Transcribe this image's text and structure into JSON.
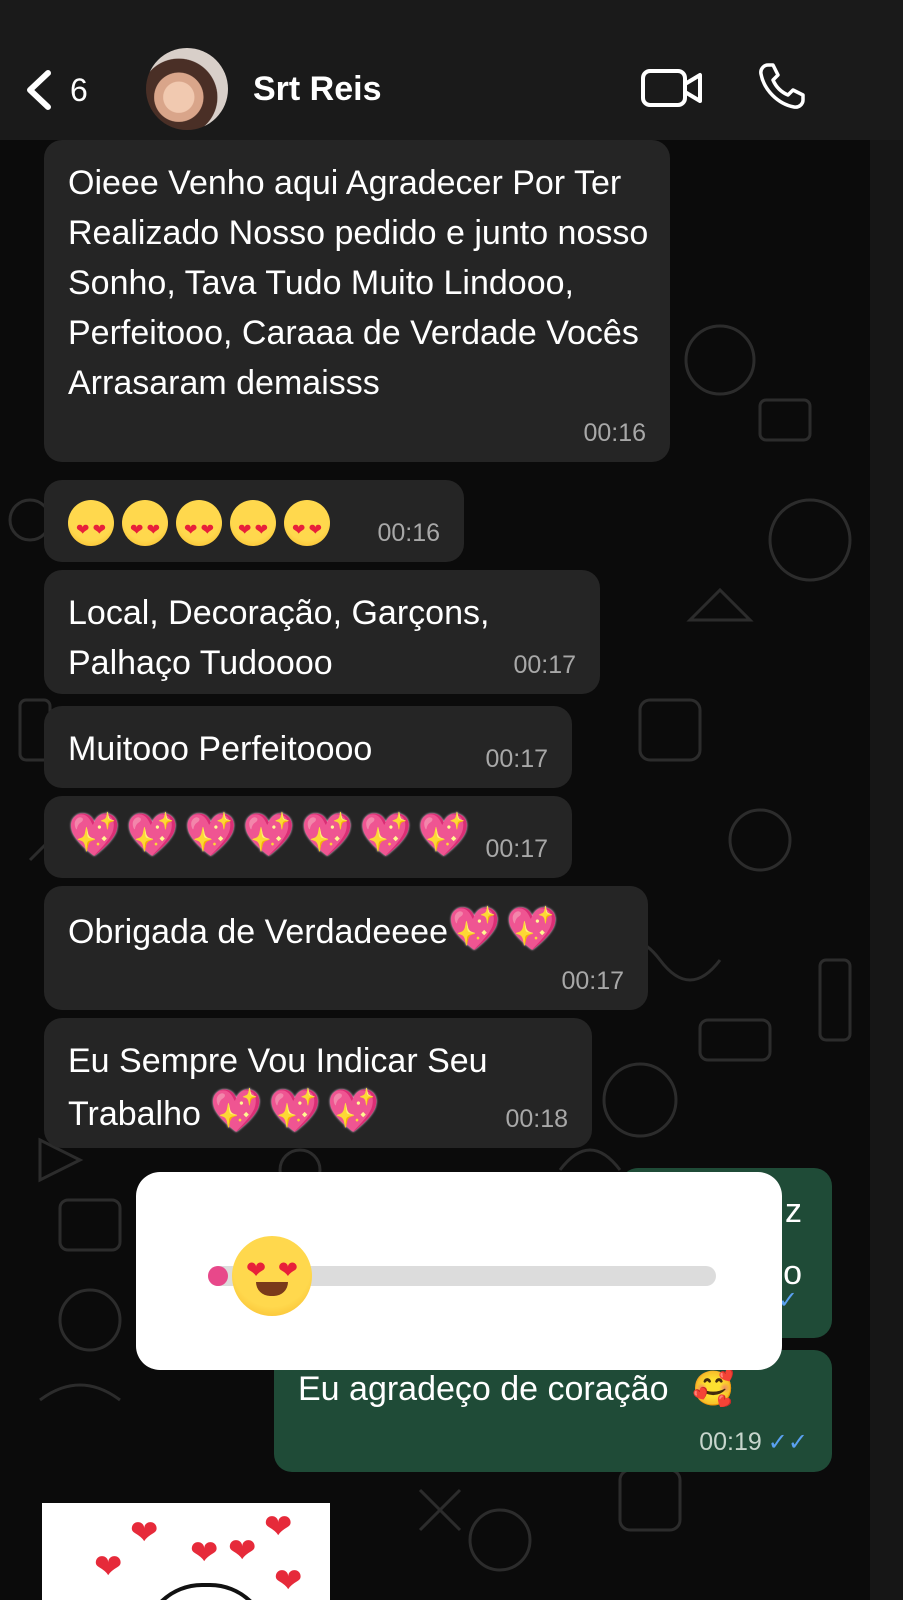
{
  "header": {
    "back_count": "6",
    "contact_name": "Srt Reis"
  },
  "messages": [
    {
      "text": "Oieee Venho aqui Agradecer Por Ter Realizado Nosso pedido e junto nosso Sonho, Tava Tudo Muito Lindooo, Perfeitooo, Caraaa de Verdade Vocês Arrasaram demaisss",
      "time": "00:16"
    },
    {
      "emoji": "smiling-face-heart-eyes",
      "emoji_count": 5,
      "time": "00:16"
    },
    {
      "text": "Local, Decoração, Garçons, Palhaço Tudoooo",
      "time": "00:17"
    },
    {
      "text": "Muitooo Perfeitoooo",
      "time": "00:17"
    },
    {
      "emoji": "sparkling-heart",
      "emoji_count": 7,
      "time": "00:17"
    },
    {
      "text": "Obrigada de Verdadeeee",
      "emoji": "sparkling-heart",
      "emoji_count": 2,
      "time": "00:17"
    },
    {
      "text": "Eu Sempre Vou Indicar Seu Trabalho",
      "emoji": "sparkling-heart",
      "emoji_count": 3,
      "time": "00:18"
    }
  ],
  "outgoing": [
    {
      "partial_text_1": "z",
      "partial_text_2": "o"
    },
    {
      "text": "Eu agradeço de coração",
      "emoji": "smiling-face-with-hearts",
      "time": "00:19"
    }
  ],
  "emoji_slider": {
    "emoji": "smiling-face-heart-eyes",
    "value": 0.02
  },
  "colors": {
    "incoming_bubble": "#252525",
    "outgoing_bubble": "#1f4b37",
    "read_ticks": "#5aa0f0",
    "header_bg": "#1a1a1a"
  }
}
